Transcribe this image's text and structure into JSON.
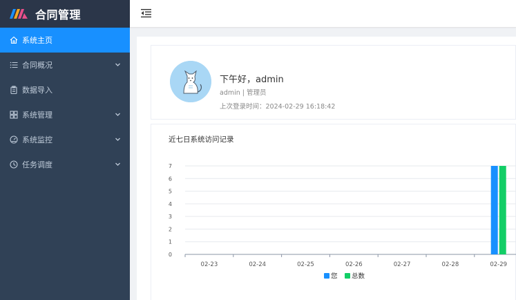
{
  "app": {
    "title": "合同管理"
  },
  "sidebar": {
    "items": [
      {
        "label": "系统主页",
        "icon": "home-icon",
        "active": true,
        "expandable": false
      },
      {
        "label": "合同概况",
        "icon": "list-icon",
        "active": false,
        "expandable": true
      },
      {
        "label": "数据导入",
        "icon": "clipboard-icon",
        "active": false,
        "expandable": false
      },
      {
        "label": "系统管理",
        "icon": "grid-icon",
        "active": false,
        "expandable": true
      },
      {
        "label": "系统监控",
        "icon": "gauge-icon",
        "active": false,
        "expandable": true
      },
      {
        "label": "任务调度",
        "icon": "clock-icon",
        "active": false,
        "expandable": true
      }
    ]
  },
  "welcome": {
    "greeting": "下午好，admin",
    "role": "admin | 管理员",
    "last_login": "上次登录时间：2024-02-29 16:18:42"
  },
  "chart": {
    "title": "近七日系统访问记录"
  },
  "chart_data": {
    "type": "bar",
    "categories": [
      "02-23",
      "02-24",
      "02-25",
      "02-26",
      "02-27",
      "02-28",
      "02-29"
    ],
    "series": [
      {
        "name": "您",
        "values": [
          0,
          0,
          0,
          0,
          0,
          0,
          7
        ],
        "color": "#1890ff"
      },
      {
        "name": "总数",
        "values": [
          0,
          0,
          0,
          0,
          0,
          0,
          7
        ],
        "color": "#13ce66"
      }
    ],
    "yticks": [
      "0",
      "1",
      "2",
      "3",
      "4",
      "5",
      "6",
      "7"
    ],
    "ylim": [
      0,
      7
    ],
    "legend_position": "bottom-center",
    "grid": true
  },
  "colors": {
    "sidebar_bg": "#304156",
    "accent": "#1890ff",
    "green": "#13ce66"
  }
}
